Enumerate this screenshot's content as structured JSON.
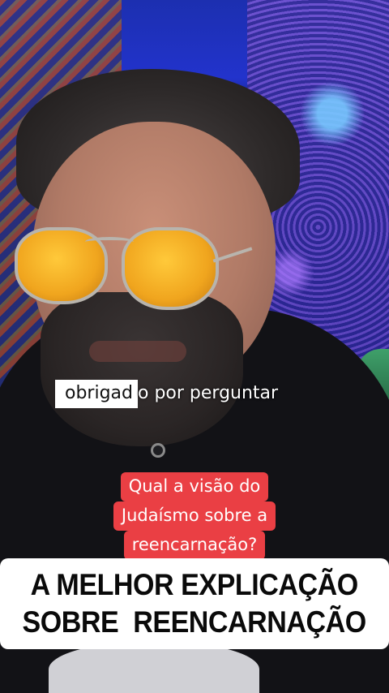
{
  "video": {
    "subtitle": {
      "highlighted": "obrigad",
      "rest": "o por perguntar"
    },
    "question_sticker": {
      "lines": [
        "Qual a visão do",
        "Judaísmo sobre a",
        "reencarnação?"
      ],
      "background_color": "#ea3f44"
    },
    "headline": {
      "lines": [
        "A MELHOR EXPLICAÇÃO",
        "SOBRE  REENCARNAÇÃO"
      ]
    }
  }
}
